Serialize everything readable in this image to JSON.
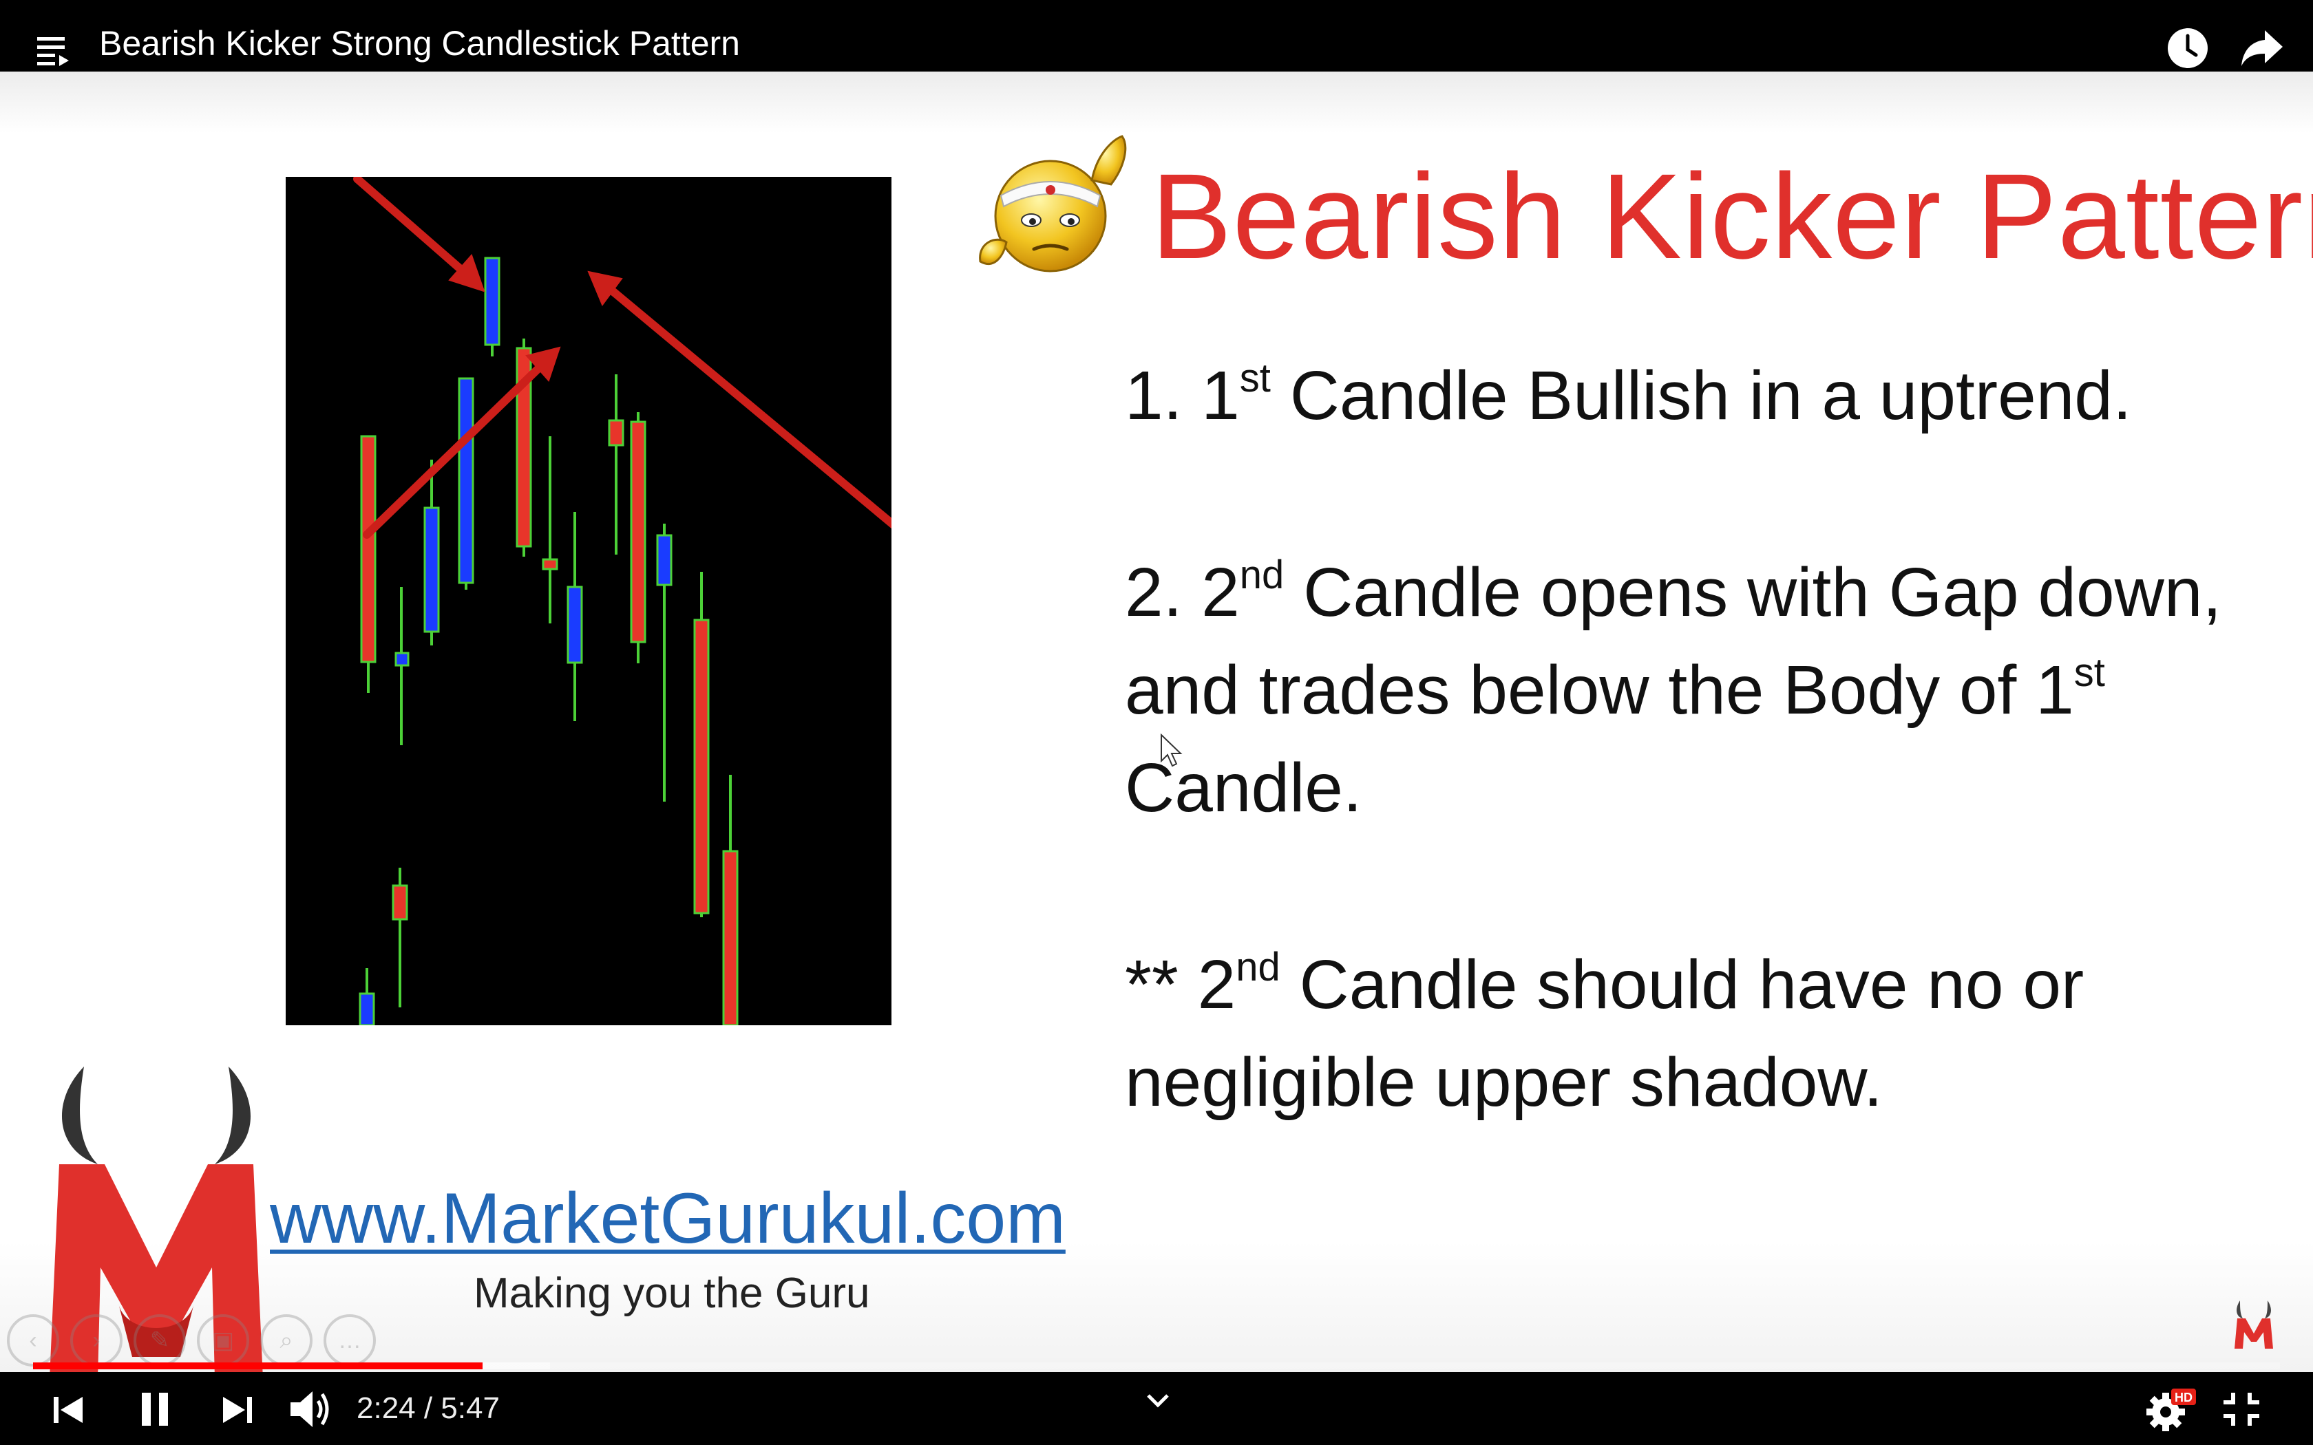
{
  "window": {
    "title": "Bearish Kicker Strong Candlestick Pattern"
  },
  "top_bar": {
    "icons": [
      "playlist-icon",
      "watch-later-icon",
      "share-icon"
    ]
  },
  "slide": {
    "title": "Bearish Kicker Pattern",
    "point1": {
      "prefix": "1.  1",
      "sup": "st",
      "rest": " Candle Bullish in a uptrend."
    },
    "point2": {
      "prefix": "2. 2",
      "sup": "nd",
      "rest": " Candle opens with Gap down, and trades below the Body of 1",
      "sup2": "st",
      "rest2": " Candle."
    },
    "point3": {
      "prefix": "** 2",
      "sup": "nd",
      "rest": " Candle should have no or negligible upper shadow."
    },
    "website": "www.MarketGurukul.com",
    "tagline": "Making you the Guru",
    "ppt_toolbar_icons": [
      "prev-slide-icon",
      "next-slide-icon",
      "pen-icon",
      "slides-icon",
      "zoom-icon",
      "more-icon"
    ],
    "ppt_toolbar_glyphs": [
      "‹",
      "›",
      "✎",
      "▣",
      "⌕",
      "…"
    ],
    "chart_image": {
      "background": "#000000",
      "candles_note": "decorative candlestick chart screenshot inside slide",
      "colors": {
        "bull": "#1a3cff",
        "bear": "#e8352a",
        "wick": "#4cd137",
        "arrow": "#cc1f1a"
      }
    }
  },
  "player": {
    "time": "2:24 / 5:47",
    "played_fraction": 0.2,
    "buffered_fraction": 0.23,
    "accent": "#ff0000",
    "hd_badge": "HD",
    "controls": [
      "prev-icon",
      "pause-icon",
      "next-icon",
      "volume-icon",
      "chevron-down-icon",
      "settings-icon",
      "exit-fullscreen-icon"
    ]
  }
}
